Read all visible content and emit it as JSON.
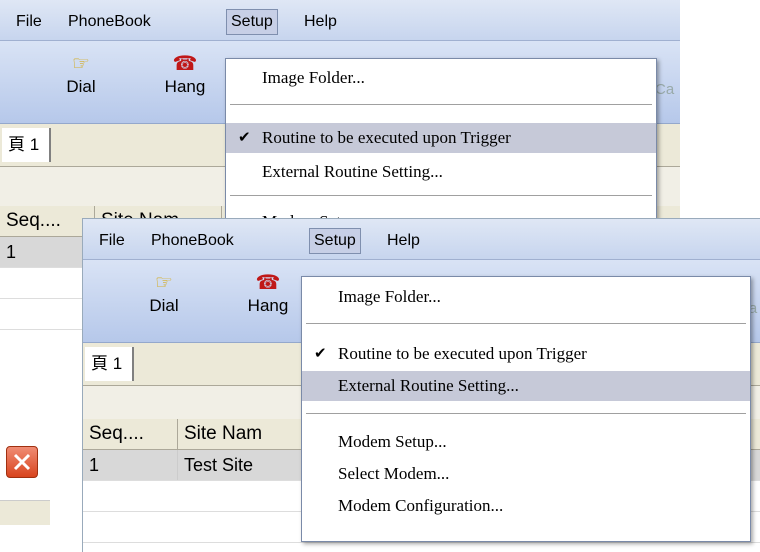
{
  "window": {
    "menus": [
      "File",
      "PhoneBook",
      "Setup",
      "Help"
    ],
    "toolbar": {
      "dial_label": "Dial",
      "hang_label": "Hang",
      "cut_label": "Ca"
    },
    "tab_label": "頁 1",
    "columns": [
      "Seq....",
      "Site Nam"
    ],
    "rows": [
      {
        "seq": "1",
        "site": "Test Site"
      }
    ]
  },
  "back_menu": {
    "items": [
      "Image Folder...",
      "Routine to be executed upon Trigger",
      "External Routine Setting...",
      "Modem Setup..."
    ],
    "checked_item": "Routine to be executed upon Trigger"
  },
  "front_menu": {
    "items": [
      "Image Folder...",
      "Routine to be executed upon Trigger",
      "External Routine Setting...",
      "Modem Setup...",
      "Select Modem...",
      "Modem Configuration..."
    ],
    "highlighted_item": "External Routine Setting..."
  },
  "icons": [
    "hand-pointer-icon",
    "telephone-icon",
    "checkmark-icon",
    "close-icon"
  ],
  "colors": {
    "menubar": "#c7d5ee",
    "highlight": "#c6c9d8",
    "close_button": "#d8441e"
  }
}
